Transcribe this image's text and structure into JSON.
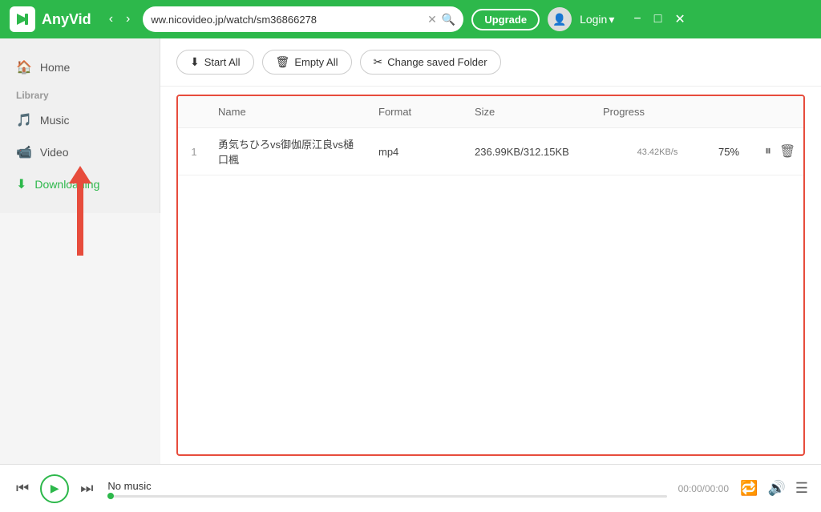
{
  "app": {
    "name": "AnyVid",
    "url": "ww.nicovideo.jp/watch/sm36866278"
  },
  "titlebar": {
    "upgrade_label": "Upgrade",
    "login_label": "Login",
    "login_arrow": "▾"
  },
  "sidebar": {
    "section_label": "Library",
    "home_label": "Home",
    "music_label": "Music",
    "video_label": "Video",
    "downloading_label": "Downloading"
  },
  "toolbar": {
    "start_all_label": "Start All",
    "empty_all_label": "Empty All",
    "change_folder_label": "Change saved Folder"
  },
  "table": {
    "headers": {
      "num": "",
      "name": "Name",
      "format": "Format",
      "size": "Size",
      "progress": "Progress",
      "actions": ""
    },
    "rows": [
      {
        "num": "1",
        "name": "勇気ちひろvs御伽原江良vs樋口楓",
        "format": "mp4",
        "size": "236.99KB/312.15KB",
        "progress_pct": "75%",
        "speed": "43.42KB/s",
        "progress_value": 75
      }
    ]
  },
  "player": {
    "track_label": "No music",
    "time": "00:00/00:00"
  }
}
